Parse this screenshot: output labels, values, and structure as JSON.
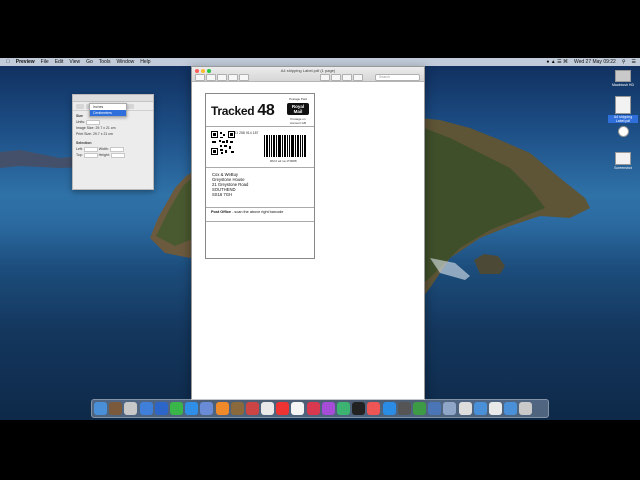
{
  "menubar": {
    "apple": "",
    "items": [
      "Preview",
      "File",
      "Edit",
      "View",
      "Go",
      "Tools",
      "Window",
      "Help"
    ],
    "clock": "Wed 27 May 09:22"
  },
  "inspector": {
    "dropdown_items": [
      "Inches",
      "Centimeters"
    ],
    "labels": [
      "Size",
      "Units:",
      "Image Size:",
      "Print Size:",
      "Selection",
      "Left:",
      "Top:",
      "Width:",
      "Height:"
    ],
    "values": [
      "29.7 x 21 cm",
      "29.7 x 21 cm"
    ]
  },
  "window": {
    "title": "A4 shipping Label.pdf (1 page)",
    "search_placeholder": "Search"
  },
  "label": {
    "service": "Tracked",
    "number": "48",
    "rm_top": "Postage Paid",
    "rm_logo": "Royal Mail",
    "rm_bottom": "Postage on Account GB",
    "reference": "DL-002 213 4001 258 914 187",
    "barcode_text": "RM  0 a2 1a 1T0088",
    "address": [
      "Cox & WeBuy",
      "Greystone House",
      "21 Greystone Road",
      "SOUTHEND",
      "SS16 7GH"
    ],
    "post_office_label": "Post Office",
    "post_office_text": "- scan the above right barcode"
  },
  "desktop_icons": [
    {
      "label": "Macintosh HD"
    },
    {
      "label": "A4 shipping Label.pdf"
    },
    {
      "label": "Screenshot"
    }
  ],
  "dock": {
    "icon_colors": [
      "#4a90d9",
      "#7a5a3a",
      "#c8c8c8",
      "#3f7fd9",
      "#2c66c8",
      "#3ab54a",
      "#2f8ee6",
      "#6a8bd6",
      "#ef8a2a",
      "#8a6a3c",
      "#c44",
      "#e9e9e9",
      "#e33",
      "#f5f5f5",
      "#d8394f",
      "#a54dd6",
      "#3cb371",
      "#222",
      "#e55",
      "#2b8ce6",
      "#555",
      "#3d9b45",
      "#4a76b8",
      "#8fa6c8",
      "#ddd",
      "#4a90d9",
      "#e9e9e9",
      "#4a90d9",
      "#c9c9c9"
    ]
  }
}
